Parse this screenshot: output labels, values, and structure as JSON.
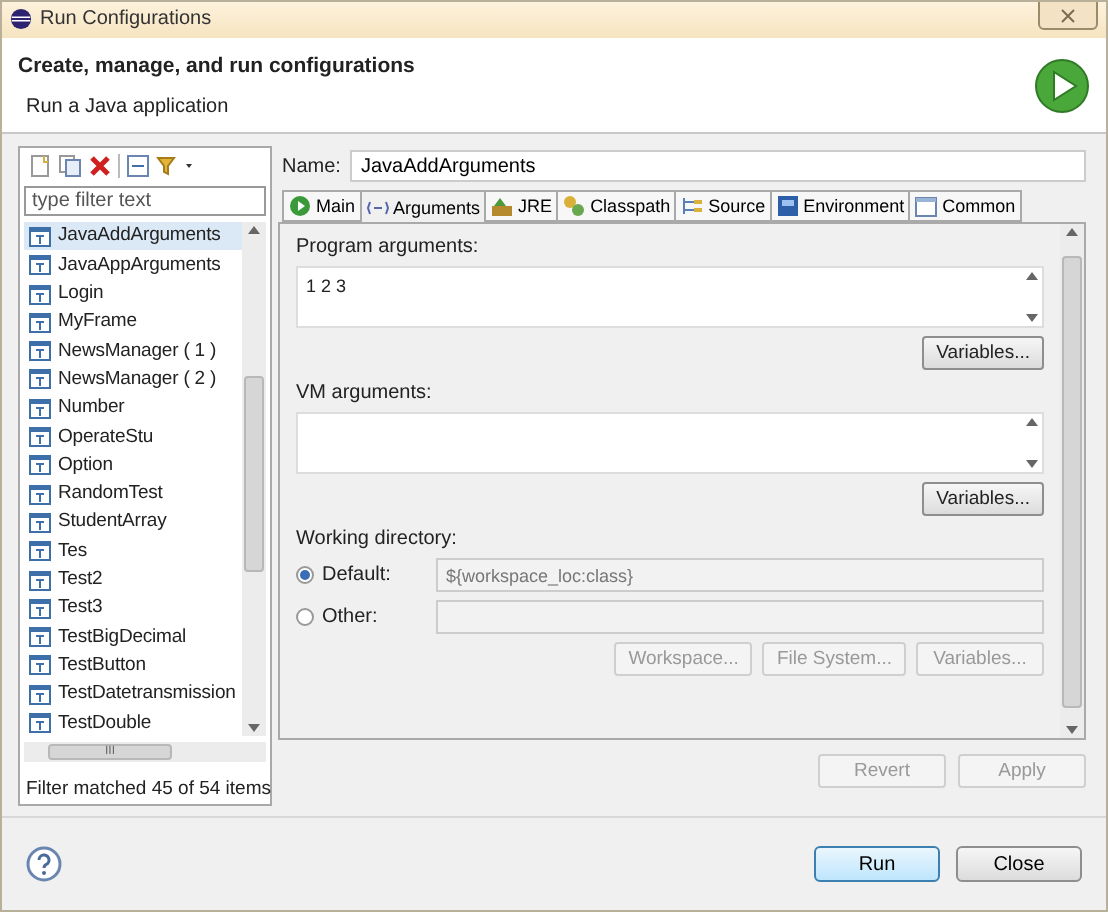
{
  "window": {
    "title": "Run Configurations"
  },
  "header": {
    "title": "Create, manage, and run configurations",
    "subtitle": "Run a Java application"
  },
  "sidebar": {
    "filter": {
      "placeholder": "type filter text"
    },
    "items": [
      {
        "label": "JavaAddArguments",
        "selected": true
      },
      {
        "label": "JavaAppArguments",
        "selected": false
      },
      {
        "label": "Login",
        "selected": false
      },
      {
        "label": "MyFrame",
        "selected": false
      },
      {
        "label": "NewsManager ( 1 )",
        "selected": false
      },
      {
        "label": "NewsManager ( 2 )",
        "selected": false
      },
      {
        "label": "Number",
        "selected": false
      },
      {
        "label": "OperateStu",
        "selected": false
      },
      {
        "label": "Option",
        "selected": false
      },
      {
        "label": "RandomTest",
        "selected": false
      },
      {
        "label": "StudentArray",
        "selected": false
      },
      {
        "label": "Tes",
        "selected": false
      },
      {
        "label": "Test2",
        "selected": false
      },
      {
        "label": "Test3",
        "selected": false
      },
      {
        "label": "TestBigDecimal",
        "selected": false
      },
      {
        "label": "TestButton",
        "selected": false
      },
      {
        "label": "TestDatetransmission",
        "selected": false
      },
      {
        "label": "TestDouble",
        "selected": false
      }
    ],
    "hscroll_label": "III",
    "status": "Filter matched 45 of 54 items"
  },
  "config": {
    "name_label": "Name:",
    "name_value": "JavaAddArguments",
    "tabs": [
      {
        "label": "Main",
        "kind": "main",
        "selected": false
      },
      {
        "label": "Arguments",
        "kind": "arguments",
        "selected": true
      },
      {
        "label": "JRE",
        "kind": "jre",
        "selected": false
      },
      {
        "label": "Classpath",
        "kind": "classpath",
        "selected": false
      },
      {
        "label": "Source",
        "kind": "source",
        "selected": false
      },
      {
        "label": "Environment",
        "kind": "environment",
        "selected": false
      },
      {
        "label": "Common",
        "kind": "common",
        "selected": false
      }
    ],
    "program_arguments": {
      "label": "Program arguments:",
      "value": "1 2 3",
      "button": "Variables..."
    },
    "vm_arguments": {
      "label": "VM arguments:",
      "button": "Variables..."
    },
    "working_directory": {
      "label": "Working directory:",
      "options": [
        {
          "label": "Default:",
          "selected": true,
          "value": "${workspace_loc:class}"
        },
        {
          "label": "Other:",
          "selected": false
        }
      ],
      "buttons": [
        {
          "label": "Workspace...",
          "disabled": true
        },
        {
          "label": "File System...",
          "disabled": true
        },
        {
          "label": "Variables...",
          "disabled": true
        }
      ]
    },
    "buttons": [
      {
        "label": "Revert",
        "disabled": true
      },
      {
        "label": "Apply",
        "disabled": true
      }
    ]
  },
  "footer": {
    "buttons": [
      {
        "label": "Run",
        "default": true
      },
      {
        "label": "Close",
        "default": false
      }
    ]
  }
}
